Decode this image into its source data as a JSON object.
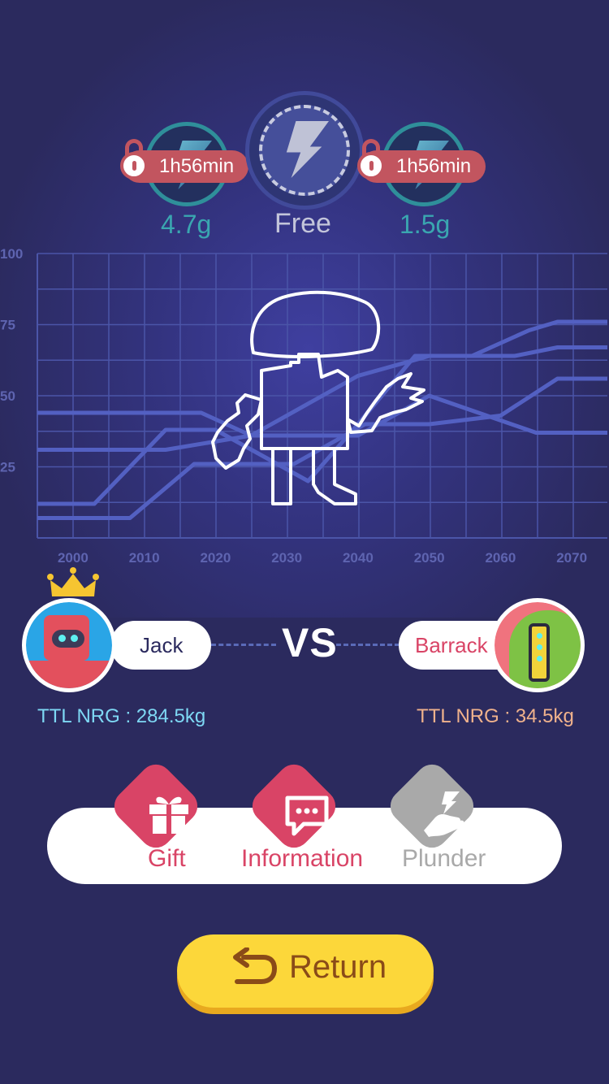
{
  "energy": {
    "left": {
      "timer": "1h56min",
      "weight": "4.7g",
      "locked": true
    },
    "center": {
      "label": "Free"
    },
    "right": {
      "timer": "1h56min",
      "weight": "1.5g",
      "locked": true
    }
  },
  "chart_data": {
    "type": "line",
    "x_ticks": [
      "2000",
      "2010",
      "2020",
      "2030",
      "2040",
      "2050",
      "2060",
      "2070"
    ],
    "y_ticks": [
      "100",
      "75",
      "50",
      "25"
    ],
    "xlim": [
      1995,
      2075
    ],
    "ylim": [
      0,
      100
    ],
    "grid": true,
    "series": [
      {
        "x": [
          1995,
          2018,
          2025,
          2040,
          2050,
          2065,
          2075
        ],
        "y": [
          44,
          44,
          36,
          36,
          50,
          37,
          37
        ]
      },
      {
        "x": [
          1995,
          2013,
          2025,
          2040,
          2050,
          2062,
          2068,
          2075
        ],
        "y": [
          31,
          31,
          36,
          57,
          64,
          64,
          67,
          67
        ]
      },
      {
        "x": [
          1995,
          2003,
          2013,
          2020,
          2033,
          2040,
          2048,
          2056,
          2064,
          2068,
          2075
        ],
        "y": [
          12,
          12,
          38,
          38,
          20,
          40,
          64,
          64,
          73,
          76,
          76
        ]
      },
      {
        "x": [
          1995,
          2008,
          2017,
          2023,
          2031,
          2041,
          2050,
          2060,
          2068,
          2075
        ],
        "y": [
          7,
          7,
          26,
          26,
          26,
          40,
          40,
          43,
          56,
          56
        ]
      }
    ]
  },
  "players": {
    "left": {
      "name": "Jack",
      "ttl": "TTL NRG : 284.5kg",
      "crowned": true
    },
    "right": {
      "name": "Barrack",
      "ttl": "TTL NRG : 34.5kg"
    },
    "vs_label": "VS"
  },
  "actions": [
    {
      "label": "Gift",
      "icon": "gift-icon",
      "color": "#d94466",
      "enabled": true
    },
    {
      "label": "Information",
      "icon": "message-icon",
      "color": "#d94466",
      "enabled": true
    },
    {
      "label": "Plunder",
      "icon": "plunder-hand-icon",
      "color": "#a9a9a9",
      "enabled": false
    }
  ],
  "return_button": {
    "label": "Return"
  },
  "colors": {
    "background": "#2b2a5e",
    "accent_pink": "#d94466",
    "ttl_left": "#7ed8f4",
    "ttl_right": "#f0b28c",
    "button_yellow": "#fcd73a"
  }
}
